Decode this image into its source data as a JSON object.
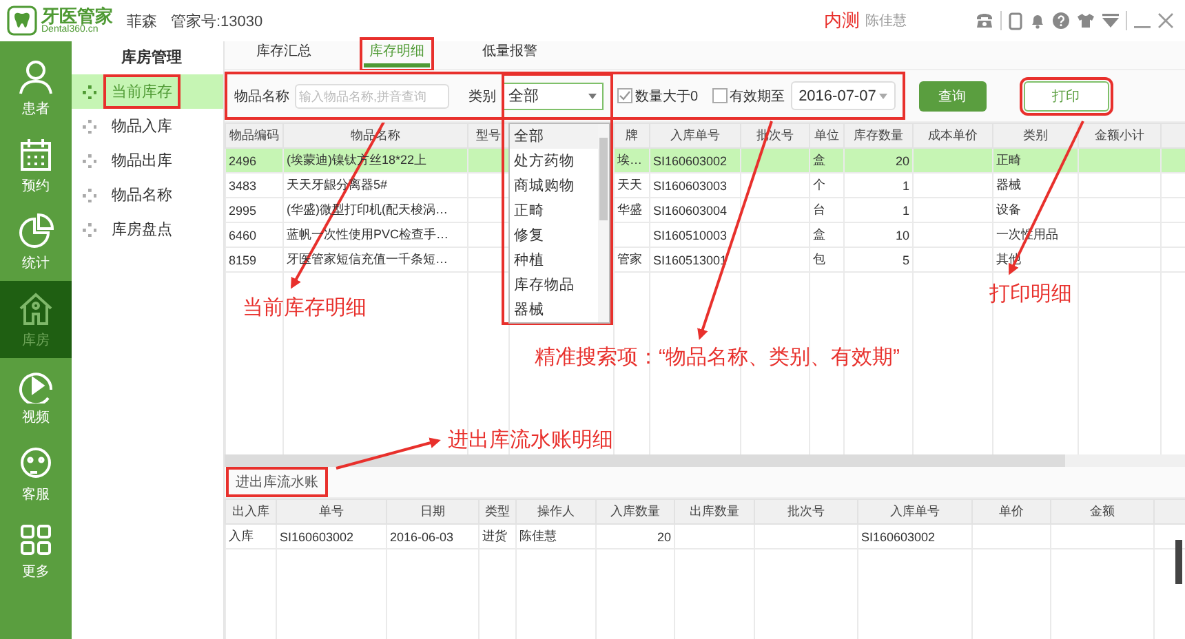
{
  "app": {
    "logo_title": "牙医管家",
    "logo_domain": "Dental360.cn",
    "user": "菲森",
    "account": "管家号:13030",
    "badge": "内测",
    "operator": "陈佳慧"
  },
  "nav": [
    {
      "label": "患者",
      "selected": false
    },
    {
      "label": "预约",
      "selected": false
    },
    {
      "label": "统计",
      "selected": false
    },
    {
      "label": "库房",
      "selected": true
    },
    {
      "label": "视频",
      "selected": false
    },
    {
      "label": "客服",
      "selected": false
    },
    {
      "label": "更多",
      "selected": false
    }
  ],
  "submenu": {
    "title": "库房管理",
    "items": [
      {
        "label": "当前库存",
        "selected": true
      },
      {
        "label": "物品入库",
        "selected": false
      },
      {
        "label": "物品出库",
        "selected": false
      },
      {
        "label": "物品名称",
        "selected": false
      },
      {
        "label": "库房盘点",
        "selected": false
      }
    ]
  },
  "tabs": [
    {
      "label": "库存汇总",
      "selected": false
    },
    {
      "label": "库存明细",
      "selected": true
    },
    {
      "label": "低量报警",
      "selected": false
    }
  ],
  "filter": {
    "name_field": {
      "label": "物品名称",
      "placeholder": "输入物品名称,拼音查询"
    },
    "category": {
      "label": "类别",
      "value": "全部",
      "options": [
        {
          "label": "全部",
          "selected": true
        },
        {
          "label": "处方药物",
          "selected": false
        },
        {
          "label": "商城购物",
          "selected": false
        },
        {
          "label": "正畸",
          "selected": false
        },
        {
          "label": "修复",
          "selected": false
        },
        {
          "label": "种植",
          "selected": false
        },
        {
          "label": "库存物品",
          "selected": false
        },
        {
          "label": "器械",
          "selected": false
        }
      ]
    },
    "qty_check": {
      "label": "数量大于0",
      "checked": true
    },
    "expiry": {
      "label": "有效期至",
      "checked": false,
      "value": "2016-07-07"
    },
    "buttons": [
      {
        "label": "查询",
        "kind": "primary"
      },
      {
        "label": "打印",
        "kind": "outline"
      }
    ]
  },
  "table": {
    "columns": [
      "物品编码",
      "物品名称",
      "型号",
      "牌",
      "入库单号",
      "批次号",
      "单位",
      "库存数量",
      "成本单价",
      "类别",
      "金额小计"
    ],
    "rows": [
      {
        "selected": true,
        "code": "2496",
        "name": "(埃蒙迪)镍钛方丝18*22上",
        "brand": "埃…",
        "in_no": "SI160603002",
        "unit": "盒",
        "qty": "20",
        "category": "正畸"
      },
      {
        "selected": false,
        "code": "3483",
        "name": "天天牙龈分离器5#",
        "brand": "天天",
        "in_no": "SI160603003",
        "unit": "个",
        "qty": "1",
        "category": "器械"
      },
      {
        "selected": false,
        "code": "2995",
        "name": "(华盛)微型打印机(配天梭涡…",
        "brand": "华盛",
        "in_no": "SI160603004",
        "unit": "台",
        "qty": "1",
        "category": "设备"
      },
      {
        "selected": false,
        "code": "6460",
        "name": "蓝帆一次性使用PVC检查手…",
        "in_no": "SI160510003",
        "unit": "盒",
        "qty": "10",
        "category": "一次性用品"
      },
      {
        "selected": false,
        "code": "8159",
        "name": "牙医管家短信充值一千条短…",
        "brand": "管家",
        "in_no": "SI160513001",
        "unit": "包",
        "qty": "5",
        "category": "其他"
      }
    ]
  },
  "flow": {
    "tab": "进出库流水账",
    "columns": [
      "出入库",
      "单号",
      "日期",
      "类型",
      "操作人",
      "入库数量",
      "出库数量",
      "批次号",
      "入库单号",
      "单价",
      "金额"
    ],
    "rows": [
      {
        "direction": "入库",
        "number": "SI160603002",
        "date": "2016-06-03",
        "type": "进货",
        "operator": "陈佳慧",
        "in_qty": "20",
        "in_number": "SI160603002"
      }
    ]
  },
  "annotations": [
    {
      "text": "当前库存明细"
    },
    {
      "text": "精准搜索项：“物品名称、类别、有效期”"
    },
    {
      "text": "打印明细"
    },
    {
      "text": "进出库流水账明细"
    }
  ]
}
